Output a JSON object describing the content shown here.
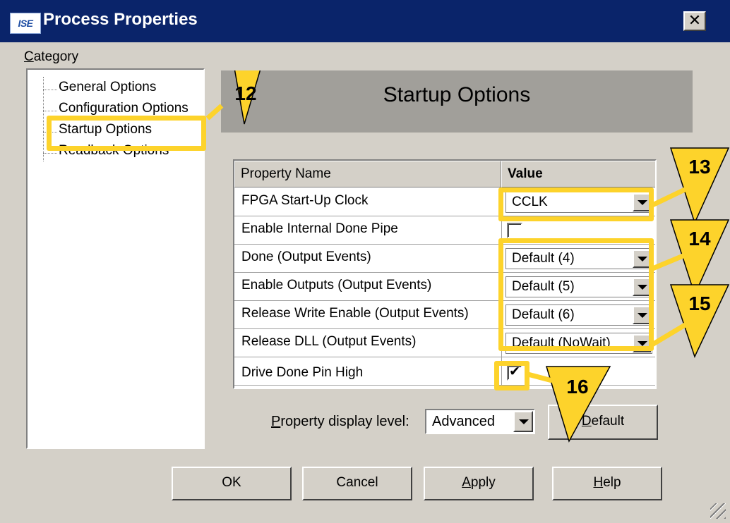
{
  "window": {
    "title": "Process Properties",
    "logo_text": "ISE"
  },
  "category": {
    "label_accel": "C",
    "label_rest": "ategory",
    "items": [
      {
        "label": "General Options"
      },
      {
        "label": "Configuration Options"
      },
      {
        "label": "Startup Options",
        "selected": true
      },
      {
        "label": "Readback Options"
      }
    ]
  },
  "panel": {
    "title": "Startup Options"
  },
  "table": {
    "headers": {
      "name": "Property Name",
      "value": "Value"
    },
    "rows": [
      {
        "name": "FPGA Start-Up Clock",
        "type": "select",
        "value": "CCLK"
      },
      {
        "name": "Enable Internal Done Pipe",
        "type": "checkbox",
        "checked": false
      },
      {
        "name": "Done (Output Events)",
        "type": "select",
        "value": "Default (4)"
      },
      {
        "name": "Enable Outputs (Output Events)",
        "type": "select",
        "value": "Default (5)"
      },
      {
        "name": "Release Write Enable (Output Events)",
        "type": "select",
        "value": "Default (6)"
      },
      {
        "name": "Release DLL (Output Events)",
        "type": "select",
        "value": "Default (NoWait)"
      },
      {
        "name": "Drive Done Pin High",
        "type": "checkbox",
        "checked": true
      }
    ]
  },
  "display_level": {
    "label_accel": "P",
    "label_rest": "roperty display level:",
    "value": "Advanced"
  },
  "buttons": {
    "default": {
      "accel": "D",
      "rest": "efault"
    },
    "ok": "OK",
    "cancel": "Cancel",
    "apply": {
      "accel": "A",
      "rest": "pply"
    },
    "help": {
      "accel": "H",
      "rest": "elp"
    }
  },
  "callouts": [
    "12",
    "13",
    "14",
    "15",
    "16"
  ],
  "colors": {
    "title_bar": "#0a246a",
    "callout": "#fdd32b",
    "dialog": "#d4d0c8",
    "header_panel": "#a19f9a"
  },
  "icons": [
    "close-icon",
    "chevron-down-icon",
    "checkmark-icon",
    "resize-grip-icon"
  ]
}
